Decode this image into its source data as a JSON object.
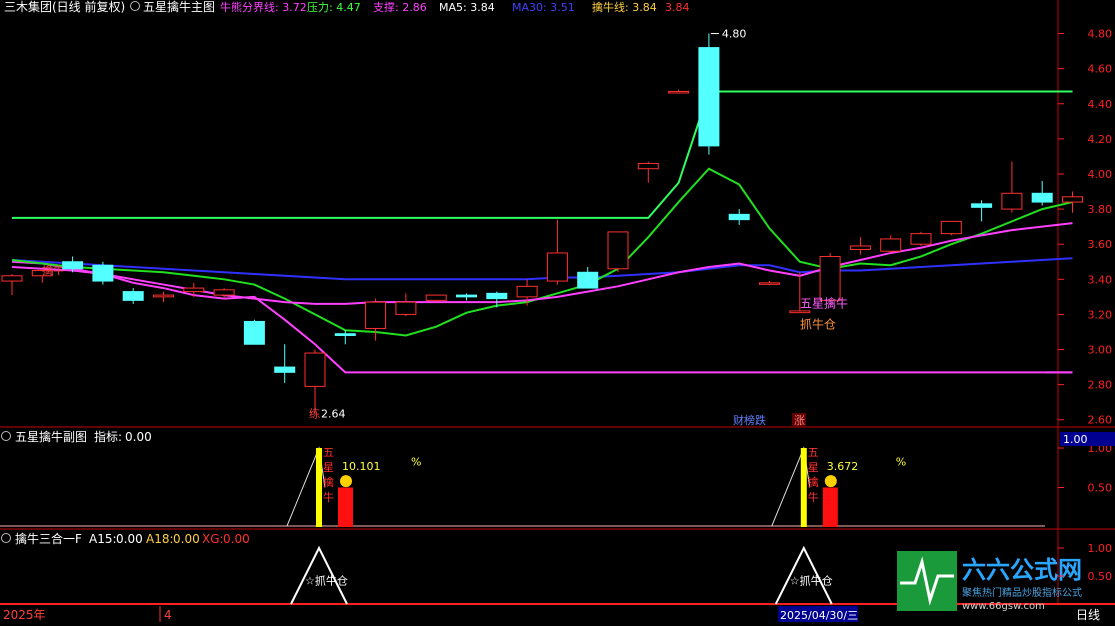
{
  "main_header": {
    "stock": "三木集团(日线 前复权)",
    "panel": "五星擒牛主图",
    "items": [
      {
        "label": "牛熊分界线:",
        "value": "3.72",
        "color": "#ff40ff"
      },
      {
        "label": "压力:",
        "value": "4.47",
        "color": "#40ff40"
      },
      {
        "label": "支撑:",
        "value": "2.86",
        "color": "#ff40ff"
      },
      {
        "label": "MA5:",
        "value": "3.84",
        "color": "#ffffff"
      },
      {
        "label": "MA30:",
        "value": "3.51",
        "color": "#4040ff"
      },
      {
        "label": "擒牛线:",
        "value": "3.84",
        "color": "#ffd040"
      },
      {
        "label": "",
        "value": "3.84",
        "color": "#ff3030"
      }
    ]
  },
  "sub1_header": {
    "panel": "五星擒牛副图",
    "label": "指标:",
    "value": "0.00"
  },
  "sub2_header": {
    "panel": "擒牛三合一F",
    "a15_label": "A15:",
    "a15": "0.00",
    "a18_label": "A18:",
    "a18": "0.00",
    "xg_label": "XG:",
    "xg": "0.00"
  },
  "annotations": {
    "high": "4.80",
    "low": "2.64",
    "low_prefix": "练",
    "buy_top": "擒牛",
    "buy_signal_1": "五星擒牛",
    "buy_signal_2": "抓牛仓",
    "news_1": "财榜跌",
    "news_2": "涨",
    "sub1_value_1": "10.101",
    "sub1_value_2": "3.672",
    "sub1_pct": "%",
    "sub1_vert_text": "五星擒牛",
    "sub2_text": "☆抓牛仓"
  },
  "bottom_bar": {
    "year": "2025年",
    "month": "4",
    "date": "2025/04/30/三",
    "period": "日线"
  },
  "sub1_axis": {
    "current": "1.00",
    "ticks": [
      "1.00",
      "0.50"
    ]
  },
  "sub2_axis": {
    "ticks": [
      "1.00",
      "0.50"
    ]
  },
  "watermark": {
    "brand": "六六公式网",
    "tagline": "聚焦热门精品炒股指标公式",
    "url": "www.66gsw.com"
  },
  "colors": {
    "up": "#ff3030",
    "down": "#54ffff",
    "grid": "#8b0000",
    "axis": "#ff2020"
  },
  "chart_data": {
    "type": "candlestick",
    "y_axis": {
      "range": [
        2.57,
        4.9
      ],
      "ticks": [
        2.6,
        2.8,
        3.0,
        3.2,
        3.4,
        3.6,
        3.8,
        4.0,
        4.2,
        4.4,
        4.6,
        4.8
      ]
    },
    "candles": [
      {
        "o": 3.39,
        "h": 3.43,
        "l": 3.31,
        "c": 3.42
      },
      {
        "o": 3.42,
        "h": 3.46,
        "l": 3.38,
        "c": 3.45
      },
      {
        "o": 3.5,
        "h": 3.53,
        "l": 3.44,
        "c": 3.46
      },
      {
        "o": 3.48,
        "h": 3.5,
        "l": 3.37,
        "c": 3.39
      },
      {
        "o": 3.33,
        "h": 3.35,
        "l": 3.26,
        "c": 3.28
      },
      {
        "o": 3.3,
        "h": 3.33,
        "l": 3.27,
        "c": 3.31
      },
      {
        "o": 3.33,
        "h": 3.38,
        "l": 3.3,
        "c": 3.35
      },
      {
        "o": 3.31,
        "h": 3.35,
        "l": 3.29,
        "c": 3.34
      },
      {
        "o": 3.16,
        "h": 3.17,
        "l": 3.03,
        "c": 3.03
      },
      {
        "o": 2.9,
        "h": 3.03,
        "l": 2.81,
        "c": 2.87
      },
      {
        "o": 2.79,
        "h": 3.0,
        "l": 2.64,
        "c": 2.98
      },
      {
        "o": 3.09,
        "h": 3.11,
        "l": 3.03,
        "c": 3.08
      },
      {
        "o": 3.12,
        "h": 3.29,
        "l": 3.05,
        "c": 3.27
      },
      {
        "o": 3.2,
        "h": 3.32,
        "l": 3.19,
        "c": 3.27
      },
      {
        "o": 3.28,
        "h": 3.31,
        "l": 3.27,
        "c": 3.31
      },
      {
        "o": 3.31,
        "h": 3.32,
        "l": 3.28,
        "c": 3.3
      },
      {
        "o": 3.32,
        "h": 3.33,
        "l": 3.24,
        "c": 3.29
      },
      {
        "o": 3.3,
        "h": 3.4,
        "l": 3.25,
        "c": 3.36
      },
      {
        "o": 3.39,
        "h": 3.74,
        "l": 3.37,
        "c": 3.55
      },
      {
        "o": 3.44,
        "h": 3.47,
        "l": 3.35,
        "c": 3.35
      },
      {
        "o": 3.46,
        "h": 3.67,
        "l": 3.44,
        "c": 3.67
      },
      {
        "o": 4.03,
        "h": 4.07,
        "l": 3.95,
        "c": 4.06
      },
      {
        "o": 4.47,
        "h": 4.48,
        "l": 4.46,
        "c": 4.47
      },
      {
        "o": 4.72,
        "h": 4.8,
        "l": 4.11,
        "c": 4.16
      },
      {
        "o": 3.77,
        "h": 3.8,
        "l": 3.71,
        "c": 3.74
      },
      {
        "o": 3.38,
        "h": 3.39,
        "l": 3.37,
        "c": 3.38
      },
      {
        "o": 3.21,
        "h": 3.44,
        "l": 3.21,
        "c": 3.22
      },
      {
        "o": 3.28,
        "h": 3.55,
        "l": 3.27,
        "c": 3.53
      },
      {
        "o": 3.57,
        "h": 3.64,
        "l": 3.54,
        "c": 3.59
      },
      {
        "o": 3.56,
        "h": 3.65,
        "l": 3.55,
        "c": 3.63
      },
      {
        "o": 3.6,
        "h": 3.67,
        "l": 3.59,
        "c": 3.66
      },
      {
        "o": 3.66,
        "h": 3.73,
        "l": 3.65,
        "c": 3.73
      },
      {
        "o": 3.83,
        "h": 3.85,
        "l": 3.73,
        "c": 3.81
      },
      {
        "o": 3.8,
        "h": 4.07,
        "l": 3.78,
        "c": 3.89
      },
      {
        "o": 3.89,
        "h": 3.96,
        "l": 3.82,
        "c": 3.84
      },
      {
        "o": 3.84,
        "h": 3.9,
        "l": 3.78,
        "c": 3.87
      }
    ],
    "series": [
      {
        "name": "牛熊分界线",
        "color": "#ff40ff",
        "values": [
          3.5,
          3.49,
          3.46,
          3.43,
          3.38,
          3.35,
          3.31,
          3.29,
          3.3,
          3.17,
          3.03,
          2.87,
          2.87,
          2.87,
          2.87,
          2.87,
          2.87,
          2.87,
          2.87,
          2.87,
          2.87,
          2.87,
          2.87,
          2.87,
          2.87,
          2.87,
          2.87,
          2.87,
          2.87,
          2.87,
          2.87,
          2.87,
          2.87,
          2.87,
          2.87,
          2.87
        ]
      },
      {
        "name": "压力",
        "color": "#30ff60",
        "values": [
          3.75,
          3.75,
          3.75,
          3.75,
          3.75,
          3.75,
          3.75,
          3.75,
          3.75,
          3.75,
          3.75,
          3.75,
          3.75,
          3.75,
          3.75,
          3.75,
          3.75,
          3.75,
          3.75,
          3.75,
          3.75,
          3.75,
          3.95,
          4.47,
          4.47,
          4.47,
          4.47,
          4.47,
          4.47,
          4.47,
          4.47,
          4.47,
          4.47,
          4.47,
          4.47,
          4.47
        ]
      },
      {
        "name": "MA30",
        "color": "#3030ff",
        "values": [
          3.51,
          3.5,
          3.49,
          3.48,
          3.47,
          3.46,
          3.45,
          3.44,
          3.43,
          3.42,
          3.41,
          3.4,
          3.4,
          3.4,
          3.4,
          3.4,
          3.4,
          3.4,
          3.41,
          3.41,
          3.42,
          3.43,
          3.44,
          3.46,
          3.48,
          3.48,
          3.44,
          3.45,
          3.45,
          3.46,
          3.47,
          3.48,
          3.49,
          3.5,
          3.51,
          3.52
        ]
      },
      {
        "name": "趋势线A",
        "color": "#20e020",
        "values": [
          3.51,
          3.49,
          3.47,
          3.46,
          3.45,
          3.44,
          3.42,
          3.4,
          3.37,
          3.29,
          3.2,
          3.11,
          3.1,
          3.08,
          3.13,
          3.21,
          3.25,
          3.27,
          3.32,
          3.37,
          3.46,
          3.64,
          3.84,
          4.03,
          3.94,
          3.69,
          3.5,
          3.46,
          3.49,
          3.48,
          3.53,
          3.6,
          3.66,
          3.73,
          3.8,
          3.84
        ]
      },
      {
        "name": "趋势线B",
        "color": "#ff40ff",
        "values": [
          3.47,
          3.46,
          3.45,
          3.43,
          3.4,
          3.37,
          3.34,
          3.31,
          3.29,
          3.27,
          3.26,
          3.26,
          3.27,
          3.27,
          3.27,
          3.27,
          3.27,
          3.28,
          3.3,
          3.33,
          3.36,
          3.4,
          3.44,
          3.47,
          3.49,
          3.45,
          3.42,
          3.47,
          3.51,
          3.55,
          3.58,
          3.62,
          3.65,
          3.68,
          3.7,
          3.72
        ]
      }
    ],
    "sub1": {
      "range": [
        0,
        1.0
      ],
      "signals": [
        {
          "index": 10,
          "value": 10.101,
          "bar": 0.5
        },
        {
          "index": 26,
          "value": 3.672,
          "bar": 0.5
        }
      ]
    },
    "sub2": {
      "range": [
        0,
        1.0
      ],
      "peaks": [
        10,
        26
      ]
    }
  }
}
